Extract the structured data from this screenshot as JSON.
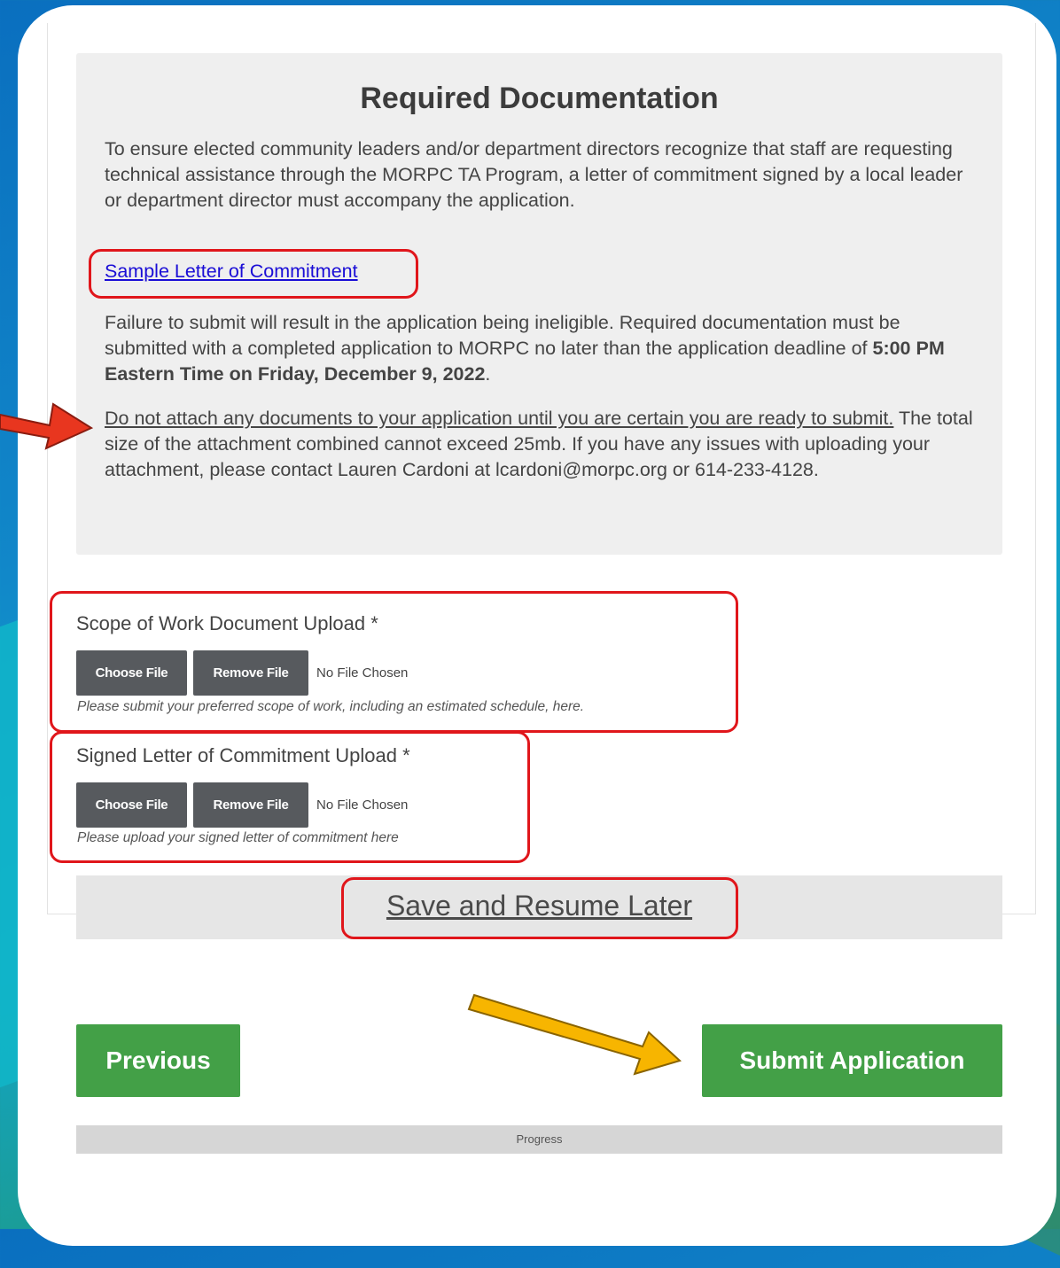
{
  "section": {
    "title": "Required Documentation",
    "intro": "To ensure elected community leaders and/or department directors recognize that staff are requesting technical assistance through the MORPC TA Program, a letter of commitment signed by a local leader or department director must accompany the application.",
    "sample_link": "Sample Letter of Commitment",
    "failure_text": "Failure to submit will result in the application being ineligible. Required documentation must be submitted with a completed application to MORPC no later than the application deadline of ",
    "deadline": "5:00 PM Eastern Time on Friday, December 9, 2022",
    "failure_end": ".",
    "warning_underlined": "Do not attach any documents to your application until you are certain you are ready to submit.",
    "warning_rest": " The total size of the attachment combined cannot exceed 25mb. If you have any issues with uploading your attachment, please contact Lauren Cardoni at lcardoni@morpc.org or 614-233-4128."
  },
  "uploads": [
    {
      "label": "Scope of Work Document Upload",
      "required_mark": "*",
      "choose_label": "Choose File",
      "remove_label": "Remove File",
      "status": "No File Chosen",
      "hint": "Please submit your preferred scope of work, including an estimated schedule, here."
    },
    {
      "label": "Signed Letter of Commitment Upload",
      "required_mark": "*",
      "choose_label": "Choose File",
      "remove_label": "Remove File",
      "status": "No File Chosen",
      "hint": "Please upload your signed letter of commitment here"
    }
  ],
  "save_link": "Save and Resume Later",
  "nav": {
    "previous_label": "Previous",
    "submit_label": "Submit Application"
  },
  "progress_label": "Progress",
  "colors": {
    "annotation_red": "#e0161b",
    "arrow_red": "#e8361f",
    "arrow_yellow": "#f7b500",
    "button_green": "#43a047",
    "button_dark": "#575a5e",
    "link_blue": "#1a0dd6"
  }
}
